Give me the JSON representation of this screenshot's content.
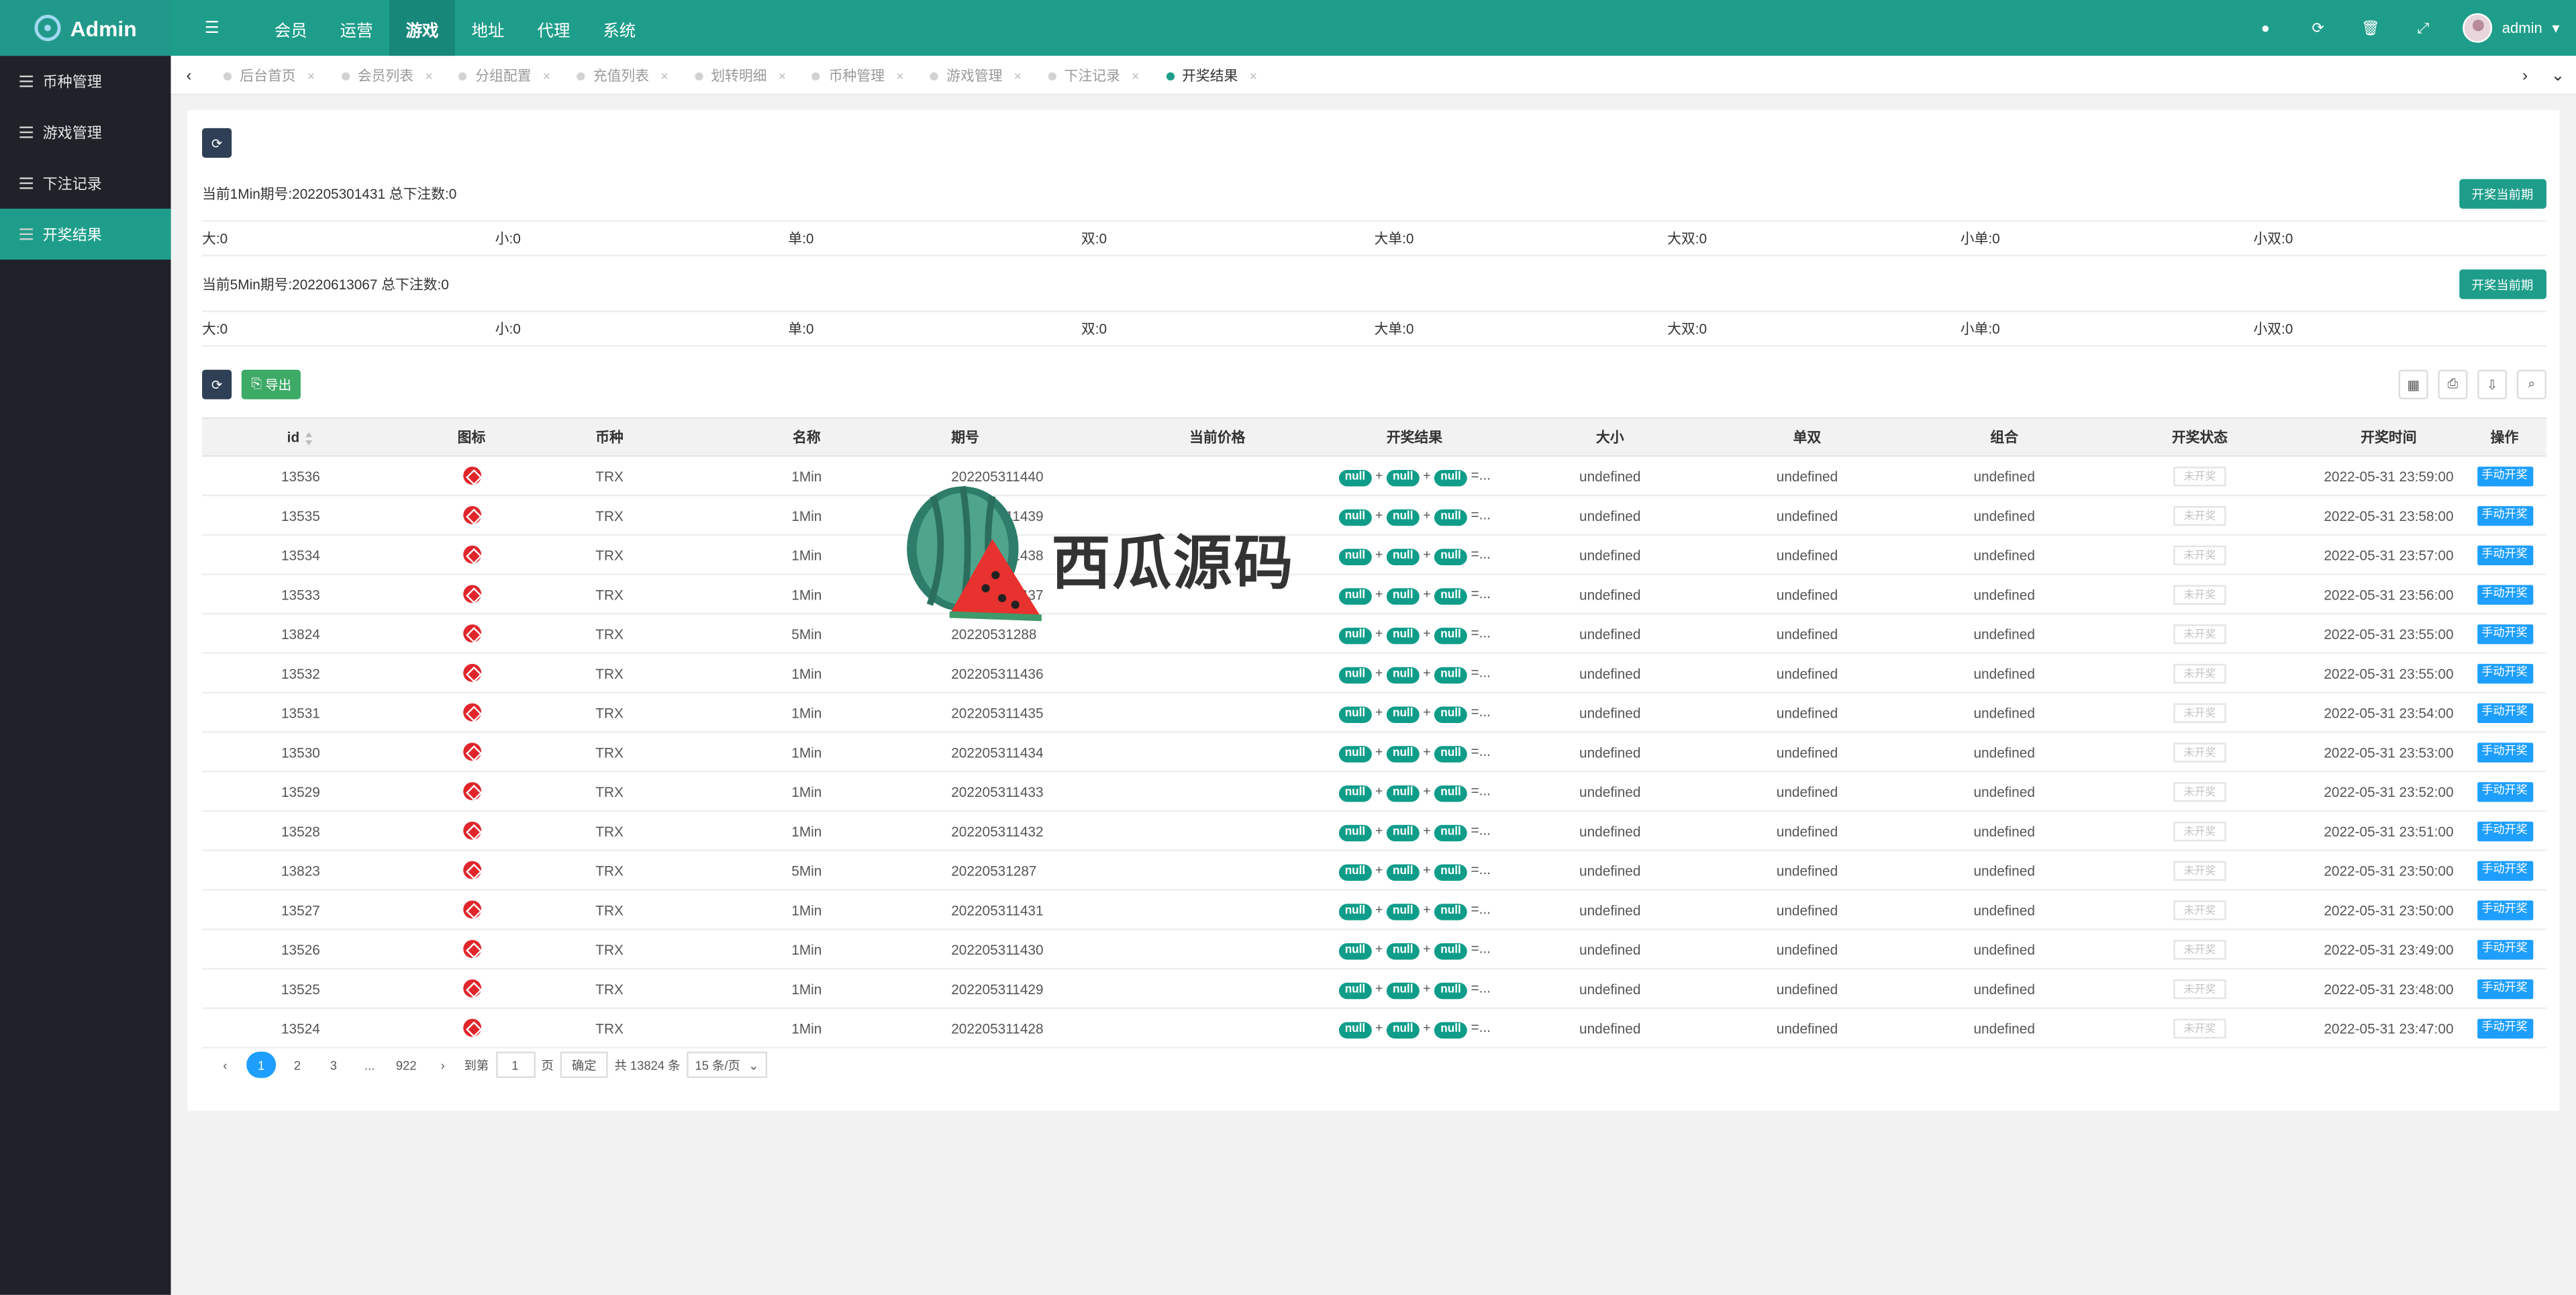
{
  "app": {
    "logo_text": "Admin"
  },
  "top_nav": [
    "会员",
    "运营",
    "游戏",
    "地址",
    "代理",
    "系统"
  ],
  "top_nav_active": "游戏",
  "top_user": "admin",
  "sidebar": [
    "币种管理",
    "游戏管理",
    "下注记录",
    "开奖结果"
  ],
  "sidebar_active": "开奖结果",
  "tabs": [
    "后台首页",
    "会员列表",
    "分组配置",
    "充值列表",
    "划转明细",
    "币种管理",
    "游戏管理",
    "下注记录",
    "开奖结果"
  ],
  "tab_active": "开奖结果",
  "period_1min": {
    "text": "当前1Min期号:202205301431 总下注数:0",
    "button": "开奖当前期"
  },
  "stats_1min": [
    "大:0",
    "小:0",
    "单:0",
    "双:0",
    "大单:0",
    "大双:0",
    "小单:0",
    "小双:0"
  ],
  "period_5min": {
    "text": "当前5Min期号:20220613067 总下注数:0",
    "button": "开奖当前期"
  },
  "stats_5min": [
    "大:0",
    "小:0",
    "单:0",
    "双:0",
    "大单:0",
    "大双:0",
    "小单:0",
    "小双:0"
  ],
  "toolbar": {
    "export_label": "导出"
  },
  "table": {
    "headers": [
      "id",
      "图标",
      "币种",
      "名称",
      "期号",
      "当前价格",
      "开奖结果",
      "大小",
      "单双",
      "组合",
      "开奖状态",
      "开奖时间",
      "操作"
    ],
    "rows": [
      {
        "id": "13536",
        "coin": "TRX",
        "name": "1Min",
        "period": "202205311440",
        "time": "2022-05-31 23:59:00"
      },
      {
        "id": "13535",
        "coin": "TRX",
        "name": "1Min",
        "period": "202205311439",
        "time": "2022-05-31 23:58:00"
      },
      {
        "id": "13534",
        "coin": "TRX",
        "name": "1Min",
        "period": "202205311438",
        "time": "2022-05-31 23:57:00"
      },
      {
        "id": "13533",
        "coin": "TRX",
        "name": "1Min",
        "period": "202205311437",
        "time": "2022-05-31 23:56:00"
      },
      {
        "id": "13824",
        "coin": "TRX",
        "name": "5Min",
        "period": "20220531288",
        "time": "2022-05-31 23:55:00"
      },
      {
        "id": "13532",
        "coin": "TRX",
        "name": "1Min",
        "period": "202205311436",
        "time": "2022-05-31 23:55:00"
      },
      {
        "id": "13531",
        "coin": "TRX",
        "name": "1Min",
        "period": "202205311435",
        "time": "2022-05-31 23:54:00"
      },
      {
        "id": "13530",
        "coin": "TRX",
        "name": "1Min",
        "period": "202205311434",
        "time": "2022-05-31 23:53:00"
      },
      {
        "id": "13529",
        "coin": "TRX",
        "name": "1Min",
        "period": "202205311433",
        "time": "2022-05-31 23:52:00"
      },
      {
        "id": "13528",
        "coin": "TRX",
        "name": "1Min",
        "period": "202205311432",
        "time": "2022-05-31 23:51:00"
      },
      {
        "id": "13823",
        "coin": "TRX",
        "name": "5Min",
        "period": "20220531287",
        "time": "2022-05-31 23:50:00"
      },
      {
        "id": "13527",
        "coin": "TRX",
        "name": "1Min",
        "period": "202205311431",
        "time": "2022-05-31 23:50:00"
      },
      {
        "id": "13526",
        "coin": "TRX",
        "name": "1Min",
        "period": "202205311430",
        "time": "2022-05-31 23:49:00"
      },
      {
        "id": "13525",
        "coin": "TRX",
        "name": "1Min",
        "period": "202205311429",
        "time": "2022-05-31 23:48:00"
      },
      {
        "id": "13524",
        "coin": "TRX",
        "name": "1Min",
        "period": "202205311428",
        "time": "2022-05-31 23:47:00"
      }
    ],
    "cell_null": "null",
    "cell_equals": "=...",
    "cell_undefined": "undefined",
    "state_label": "未开奖",
    "op_label": "手动开奖"
  },
  "pager": {
    "pages": [
      "1",
      "2",
      "3",
      "...",
      "922"
    ],
    "current": "1",
    "goto_label": "到第",
    "goto_value": "1",
    "page_unit": "页",
    "confirm": "确定",
    "total": "共 13824 条",
    "per_page": "15 条/页"
  },
  "watermark_text": "西瓜源码",
  "colors": {
    "topbar": "#1e9e8a",
    "sidebar": "#20222a",
    "primary_btn": "#1e9fff",
    "pill": "#0f9d8a"
  }
}
